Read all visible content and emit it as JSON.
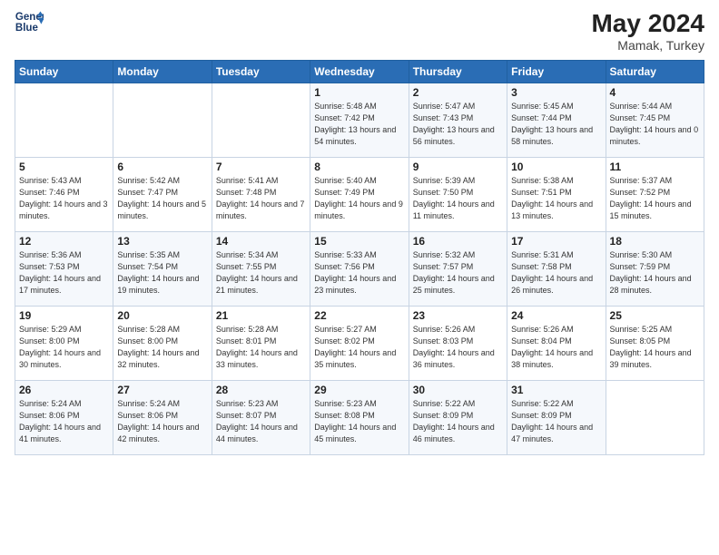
{
  "header": {
    "logo_line1": "General",
    "logo_line2": "Blue",
    "title": "May 2024",
    "location": "Mamak, Turkey"
  },
  "days_of_week": [
    "Sunday",
    "Monday",
    "Tuesday",
    "Wednesday",
    "Thursday",
    "Friday",
    "Saturday"
  ],
  "weeks": [
    [
      {
        "day": "",
        "sunrise": "",
        "sunset": "",
        "daylight": ""
      },
      {
        "day": "",
        "sunrise": "",
        "sunset": "",
        "daylight": ""
      },
      {
        "day": "",
        "sunrise": "",
        "sunset": "",
        "daylight": ""
      },
      {
        "day": "1",
        "sunrise": "Sunrise: 5:48 AM",
        "sunset": "Sunset: 7:42 PM",
        "daylight": "Daylight: 13 hours and 54 minutes."
      },
      {
        "day": "2",
        "sunrise": "Sunrise: 5:47 AM",
        "sunset": "Sunset: 7:43 PM",
        "daylight": "Daylight: 13 hours and 56 minutes."
      },
      {
        "day": "3",
        "sunrise": "Sunrise: 5:45 AM",
        "sunset": "Sunset: 7:44 PM",
        "daylight": "Daylight: 13 hours and 58 minutes."
      },
      {
        "day": "4",
        "sunrise": "Sunrise: 5:44 AM",
        "sunset": "Sunset: 7:45 PM",
        "daylight": "Daylight: 14 hours and 0 minutes."
      }
    ],
    [
      {
        "day": "5",
        "sunrise": "Sunrise: 5:43 AM",
        "sunset": "Sunset: 7:46 PM",
        "daylight": "Daylight: 14 hours and 3 minutes."
      },
      {
        "day": "6",
        "sunrise": "Sunrise: 5:42 AM",
        "sunset": "Sunset: 7:47 PM",
        "daylight": "Daylight: 14 hours and 5 minutes."
      },
      {
        "day": "7",
        "sunrise": "Sunrise: 5:41 AM",
        "sunset": "Sunset: 7:48 PM",
        "daylight": "Daylight: 14 hours and 7 minutes."
      },
      {
        "day": "8",
        "sunrise": "Sunrise: 5:40 AM",
        "sunset": "Sunset: 7:49 PM",
        "daylight": "Daylight: 14 hours and 9 minutes."
      },
      {
        "day": "9",
        "sunrise": "Sunrise: 5:39 AM",
        "sunset": "Sunset: 7:50 PM",
        "daylight": "Daylight: 14 hours and 11 minutes."
      },
      {
        "day": "10",
        "sunrise": "Sunrise: 5:38 AM",
        "sunset": "Sunset: 7:51 PM",
        "daylight": "Daylight: 14 hours and 13 minutes."
      },
      {
        "day": "11",
        "sunrise": "Sunrise: 5:37 AM",
        "sunset": "Sunset: 7:52 PM",
        "daylight": "Daylight: 14 hours and 15 minutes."
      }
    ],
    [
      {
        "day": "12",
        "sunrise": "Sunrise: 5:36 AM",
        "sunset": "Sunset: 7:53 PM",
        "daylight": "Daylight: 14 hours and 17 minutes."
      },
      {
        "day": "13",
        "sunrise": "Sunrise: 5:35 AM",
        "sunset": "Sunset: 7:54 PM",
        "daylight": "Daylight: 14 hours and 19 minutes."
      },
      {
        "day": "14",
        "sunrise": "Sunrise: 5:34 AM",
        "sunset": "Sunset: 7:55 PM",
        "daylight": "Daylight: 14 hours and 21 minutes."
      },
      {
        "day": "15",
        "sunrise": "Sunrise: 5:33 AM",
        "sunset": "Sunset: 7:56 PM",
        "daylight": "Daylight: 14 hours and 23 minutes."
      },
      {
        "day": "16",
        "sunrise": "Sunrise: 5:32 AM",
        "sunset": "Sunset: 7:57 PM",
        "daylight": "Daylight: 14 hours and 25 minutes."
      },
      {
        "day": "17",
        "sunrise": "Sunrise: 5:31 AM",
        "sunset": "Sunset: 7:58 PM",
        "daylight": "Daylight: 14 hours and 26 minutes."
      },
      {
        "day": "18",
        "sunrise": "Sunrise: 5:30 AM",
        "sunset": "Sunset: 7:59 PM",
        "daylight": "Daylight: 14 hours and 28 minutes."
      }
    ],
    [
      {
        "day": "19",
        "sunrise": "Sunrise: 5:29 AM",
        "sunset": "Sunset: 8:00 PM",
        "daylight": "Daylight: 14 hours and 30 minutes."
      },
      {
        "day": "20",
        "sunrise": "Sunrise: 5:28 AM",
        "sunset": "Sunset: 8:00 PM",
        "daylight": "Daylight: 14 hours and 32 minutes."
      },
      {
        "day": "21",
        "sunrise": "Sunrise: 5:28 AM",
        "sunset": "Sunset: 8:01 PM",
        "daylight": "Daylight: 14 hours and 33 minutes."
      },
      {
        "day": "22",
        "sunrise": "Sunrise: 5:27 AM",
        "sunset": "Sunset: 8:02 PM",
        "daylight": "Daylight: 14 hours and 35 minutes."
      },
      {
        "day": "23",
        "sunrise": "Sunrise: 5:26 AM",
        "sunset": "Sunset: 8:03 PM",
        "daylight": "Daylight: 14 hours and 36 minutes."
      },
      {
        "day": "24",
        "sunrise": "Sunrise: 5:26 AM",
        "sunset": "Sunset: 8:04 PM",
        "daylight": "Daylight: 14 hours and 38 minutes."
      },
      {
        "day": "25",
        "sunrise": "Sunrise: 5:25 AM",
        "sunset": "Sunset: 8:05 PM",
        "daylight": "Daylight: 14 hours and 39 minutes."
      }
    ],
    [
      {
        "day": "26",
        "sunrise": "Sunrise: 5:24 AM",
        "sunset": "Sunset: 8:06 PM",
        "daylight": "Daylight: 14 hours and 41 minutes."
      },
      {
        "day": "27",
        "sunrise": "Sunrise: 5:24 AM",
        "sunset": "Sunset: 8:06 PM",
        "daylight": "Daylight: 14 hours and 42 minutes."
      },
      {
        "day": "28",
        "sunrise": "Sunrise: 5:23 AM",
        "sunset": "Sunset: 8:07 PM",
        "daylight": "Daylight: 14 hours and 44 minutes."
      },
      {
        "day": "29",
        "sunrise": "Sunrise: 5:23 AM",
        "sunset": "Sunset: 8:08 PM",
        "daylight": "Daylight: 14 hours and 45 minutes."
      },
      {
        "day": "30",
        "sunrise": "Sunrise: 5:22 AM",
        "sunset": "Sunset: 8:09 PM",
        "daylight": "Daylight: 14 hours and 46 minutes."
      },
      {
        "day": "31",
        "sunrise": "Sunrise: 5:22 AM",
        "sunset": "Sunset: 8:09 PM",
        "daylight": "Daylight: 14 hours and 47 minutes."
      },
      {
        "day": "",
        "sunrise": "",
        "sunset": "",
        "daylight": ""
      }
    ]
  ]
}
